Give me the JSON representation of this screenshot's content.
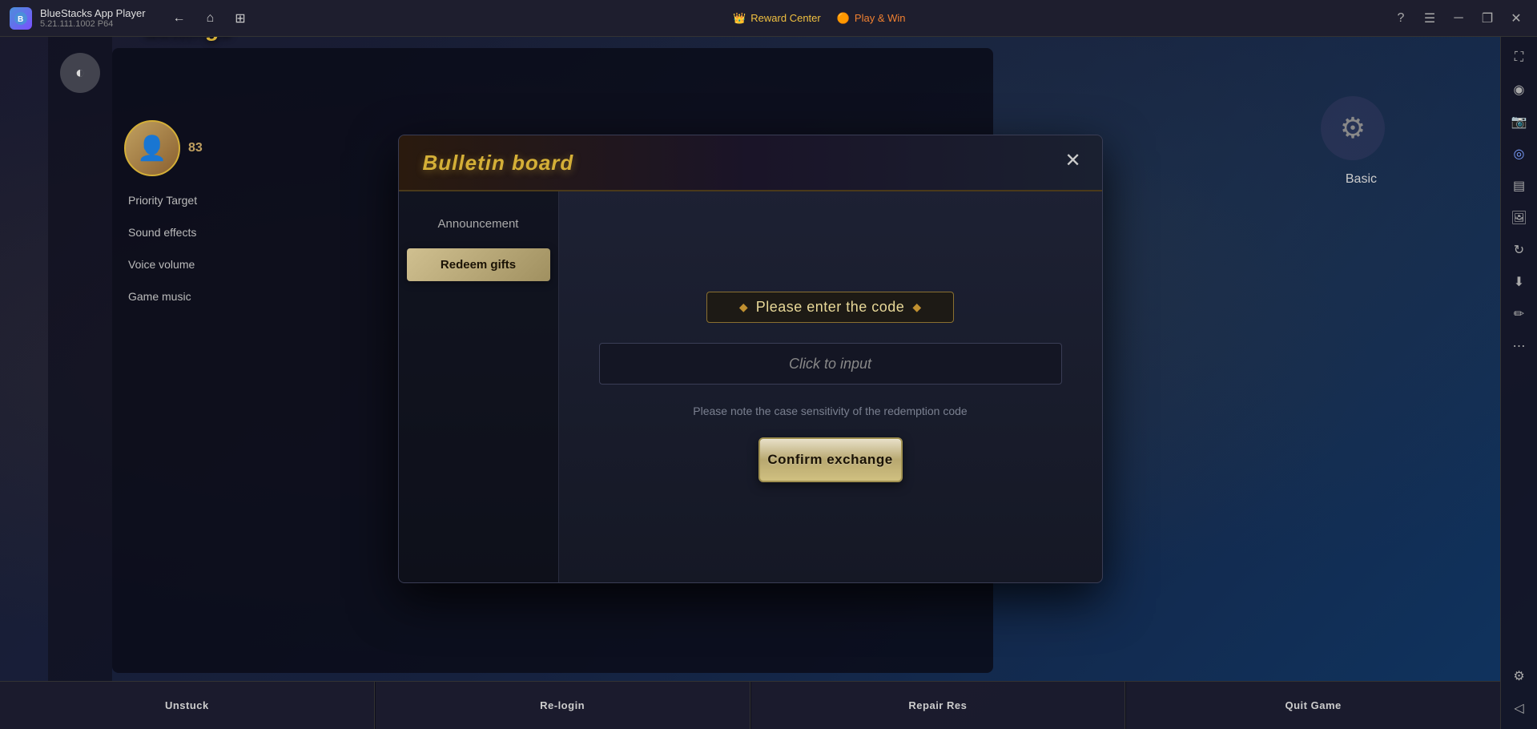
{
  "titleBar": {
    "appTitle": "BlueStacks App Player",
    "appVersion": "5.21.111.1002  P64",
    "logoText": "B",
    "rewardCenter": "Reward Center",
    "playWin": "Play & Win",
    "navBack": "←",
    "navHome": "⌂",
    "navBookmark": "⊞",
    "btnHelp": "?",
    "btnMenu": "☰",
    "btnMinimize": "─",
    "btnRestore": "❐",
    "btnClose": "✕"
  },
  "bulletinBoard": {
    "title": "Bulletin board",
    "closeBtn": "✕",
    "tabs": [
      {
        "id": "announcement",
        "label": "Announcement",
        "active": false
      },
      {
        "id": "redeem-gifts",
        "label": "Redeem gifts",
        "active": true
      }
    ],
    "content": {
      "codeHeaderText": "Please enter the code",
      "inputPlaceholder": "Click to input",
      "noteText": "Please note the case sensitivity of the redemption code",
      "confirmBtn": "Confirm exchange"
    }
  },
  "settings": {
    "title": "Settings",
    "closeBtn": "✕",
    "gear": "⚙",
    "basicLabel": "Basic",
    "menuItems": [
      {
        "id": "priority-target",
        "label": "Priority Target"
      },
      {
        "id": "sound-effects",
        "label": "Sound effects"
      },
      {
        "id": "voice-volume",
        "label": "Voice volume"
      },
      {
        "id": "game-music",
        "label": "Game music"
      }
    ]
  },
  "bottomBar": {
    "buttons": [
      {
        "id": "unstuck",
        "label": "Unstuck"
      },
      {
        "id": "re-login",
        "label": "Re-login"
      },
      {
        "id": "repair-res",
        "label": "Repair Res"
      },
      {
        "id": "quit-game",
        "label": "Quit Game"
      }
    ]
  },
  "rightSidebar": {
    "icons": [
      {
        "id": "fullscreen-icon",
        "symbol": "⛶"
      },
      {
        "id": "record-icon",
        "symbol": "◉"
      },
      {
        "id": "screenshot-icon",
        "symbol": "📷"
      },
      {
        "id": "location-icon",
        "symbol": "◎"
      },
      {
        "id": "layers-icon",
        "symbol": "▤"
      },
      {
        "id": "image-icon",
        "symbol": "🖼"
      },
      {
        "id": "rotate-icon",
        "symbol": "↻"
      },
      {
        "id": "download-icon",
        "symbol": "⬇"
      },
      {
        "id": "brush-icon",
        "symbol": "✏"
      },
      {
        "id": "more-icon",
        "symbol": "⋯"
      },
      {
        "id": "settings-sidebar-icon",
        "symbol": "⚙"
      },
      {
        "id": "arrow-icon",
        "symbol": "◁"
      }
    ]
  }
}
